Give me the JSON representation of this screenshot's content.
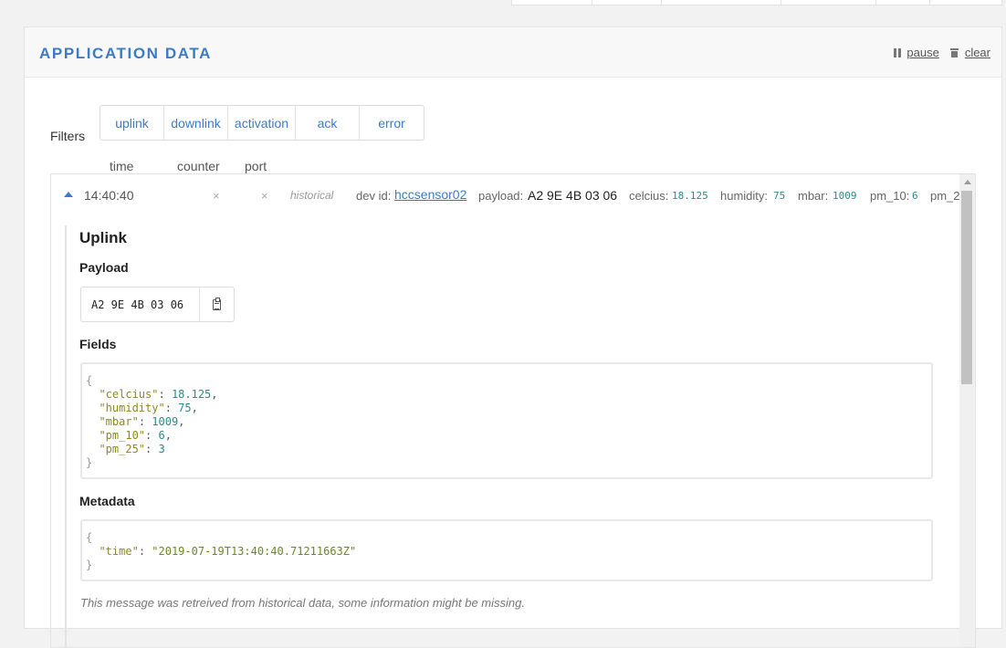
{
  "panel": {
    "title": "APPLICATION DATA",
    "pause_label": "pause",
    "clear_label": "clear"
  },
  "filters": {
    "label": "Filters",
    "items": [
      "uplink",
      "downlink",
      "activation",
      "ack",
      "error"
    ]
  },
  "columns": {
    "time": "time",
    "counter": "counter",
    "port": "port"
  },
  "message": {
    "time": "14:40:40",
    "counter": "×",
    "port": "×",
    "source": "historical",
    "dev_id_label": "dev id:",
    "dev_id": "hccsensor02",
    "payload_label": "payload:",
    "payload": "A2 9E 4B 03 06",
    "fields_inline": [
      {
        "key": "celcius:",
        "value": "18.125"
      },
      {
        "key": "humidity:",
        "value": "75"
      },
      {
        "key": "mbar:",
        "value": "1009"
      },
      {
        "key": "pm_10:",
        "value": "6"
      },
      {
        "key": "pm_2",
        "value": ""
      }
    ]
  },
  "detail": {
    "title": "Uplink",
    "payload_heading": "Payload",
    "payload_value": "A2 9E 4B 03 06",
    "fields_heading": "Fields",
    "fields": [
      {
        "key": "\"celcius\"",
        "value": "18.125",
        "sep": ","
      },
      {
        "key": "\"humidity\"",
        "value": "75",
        "sep": ","
      },
      {
        "key": "\"mbar\"",
        "value": "1009",
        "sep": ","
      },
      {
        "key": "\"pm_10\"",
        "value": "6",
        "sep": ","
      },
      {
        "key": "\"pm_25\"",
        "value": "3",
        "sep": ""
      }
    ],
    "metadata_heading": "Metadata",
    "metadata": [
      {
        "key": "\"time\"",
        "value": "\"2019-07-19T13:40:40.71211663Z\""
      }
    ],
    "note": "This message was retreived from historical data, some information might be missing."
  }
}
